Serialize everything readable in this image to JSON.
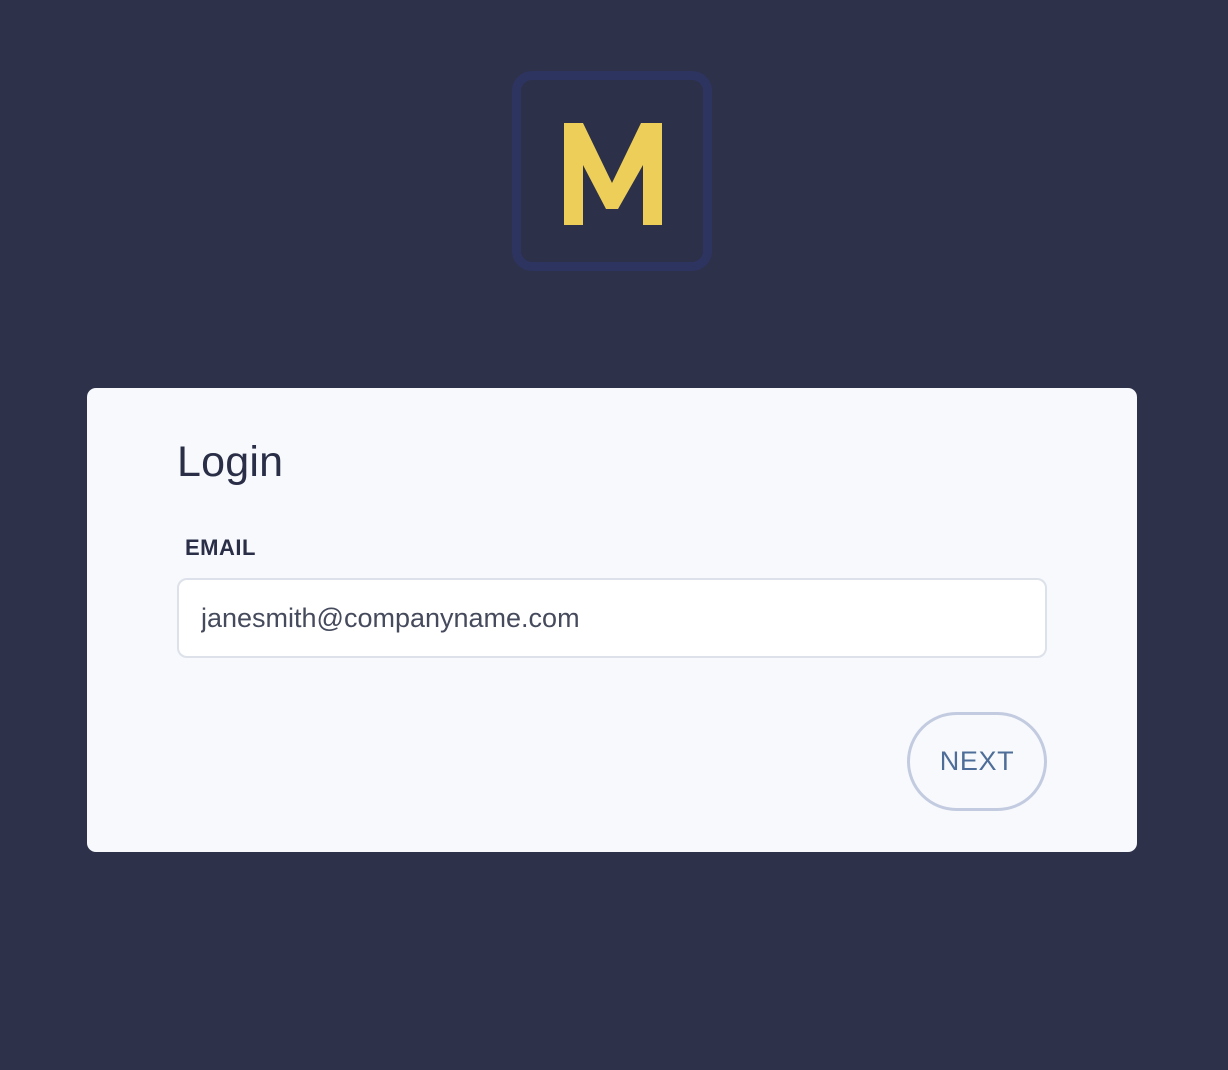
{
  "logo": {
    "icon": "m-letter-logo-icon",
    "letter": "M",
    "colors": {
      "letter": "#ecce59",
      "frame_border": "#2d3460",
      "frame_fill": "#2c3049"
    }
  },
  "login": {
    "title": "Login",
    "email_label": "EMAIL",
    "email_value": "janesmith@companyname.com",
    "next_label": "NEXT"
  },
  "colors": {
    "page_background": "#2e314a",
    "card_background": "#f7f9fc",
    "text_dark": "#2a2e47",
    "button_text": "#4e6e99",
    "button_border": "#c3cbe0"
  }
}
